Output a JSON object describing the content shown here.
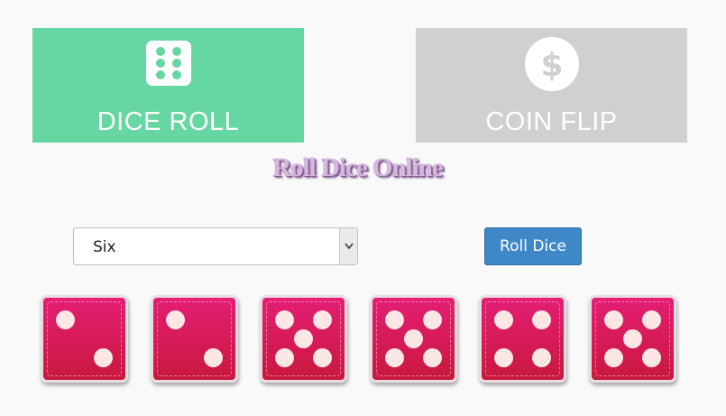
{
  "tabs": [
    {
      "label": "DICE ROLL",
      "icon": "dice-six-icon",
      "active": true
    },
    {
      "label": "COIN FLIP",
      "icon": "dollar-coin-icon",
      "active": false
    }
  ],
  "page_title": "Roll Dice Online",
  "dice_count_select": {
    "selected": "Six"
  },
  "roll_button": {
    "label": "Roll Dice"
  },
  "dice": [
    2,
    2,
    5,
    5,
    4,
    5
  ],
  "colors": {
    "dice_tab": "#66d6a2",
    "coin_tab": "#d0d0d0",
    "button": "#3f88c8",
    "die_top": "#e41e74",
    "die_bottom": "#c9183e",
    "pip": "#fce7e4"
  }
}
